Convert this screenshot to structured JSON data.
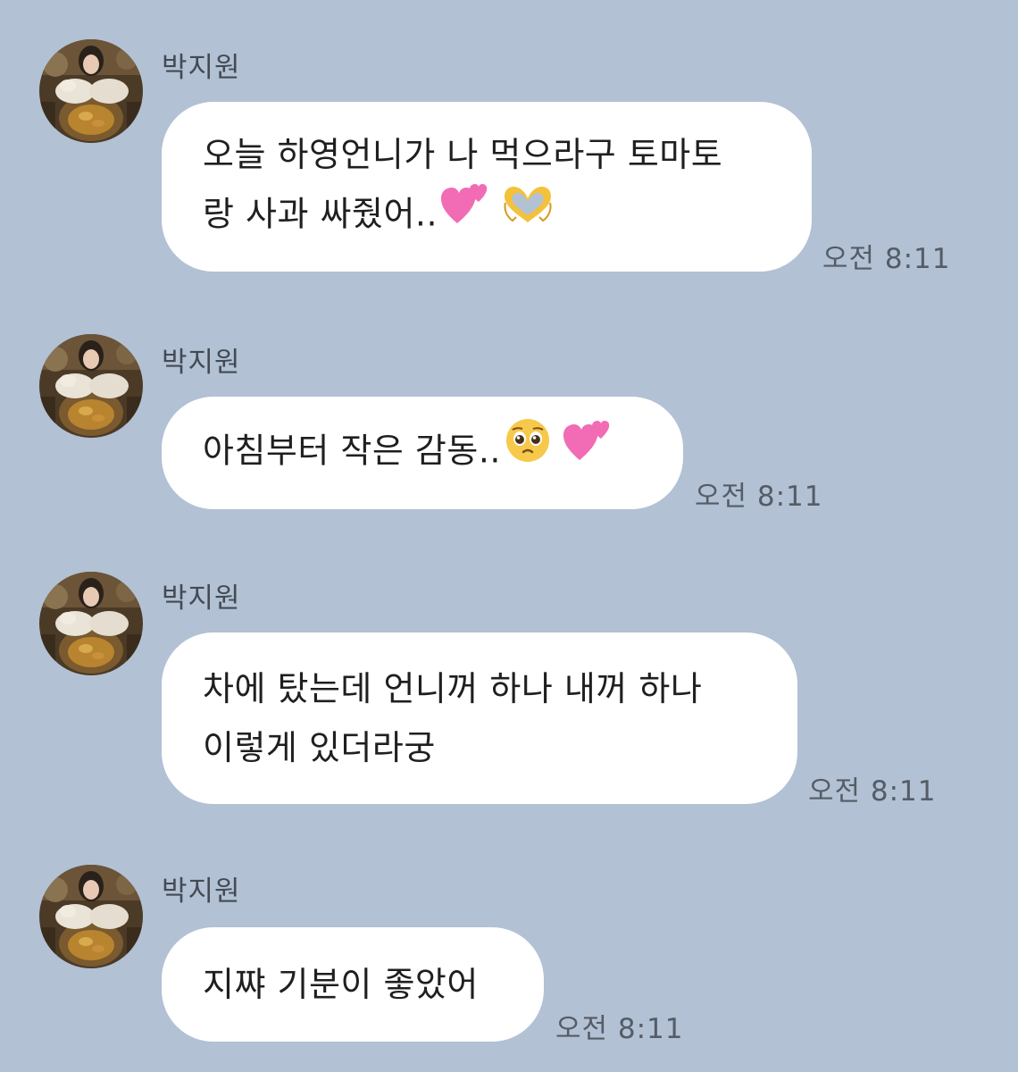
{
  "colors": {
    "background": "#B2C1D4",
    "bubble": "#FFFFFF",
    "sender_text": "#434A52",
    "time_text": "#555C66"
  },
  "messages": [
    {
      "sender": "박지원",
      "lines": [
        "오늘 하영언니가 나 먹으라구 토마토",
        "랑 사과 싸줬어.."
      ],
      "emojis": [
        "two-hearts-icon",
        "heart-hands-icon"
      ],
      "time": "오전 8:11"
    },
    {
      "sender": "박지원",
      "lines": [
        "아침부터 작은 감동.."
      ],
      "emojis": [
        "pleading-face-icon",
        "two-hearts-icon"
      ],
      "time": "오전 8:11"
    },
    {
      "sender": "박지원",
      "lines": [
        "차에 탔는데 언니꺼 하나 내꺼 하나",
        "이렇게 있더라궁"
      ],
      "emojis": [],
      "time": "오전 8:11"
    },
    {
      "sender": "박지원",
      "lines": [
        "지쨔 기분이 좋았어"
      ],
      "emojis": [],
      "time": "오전 8:11"
    }
  ]
}
